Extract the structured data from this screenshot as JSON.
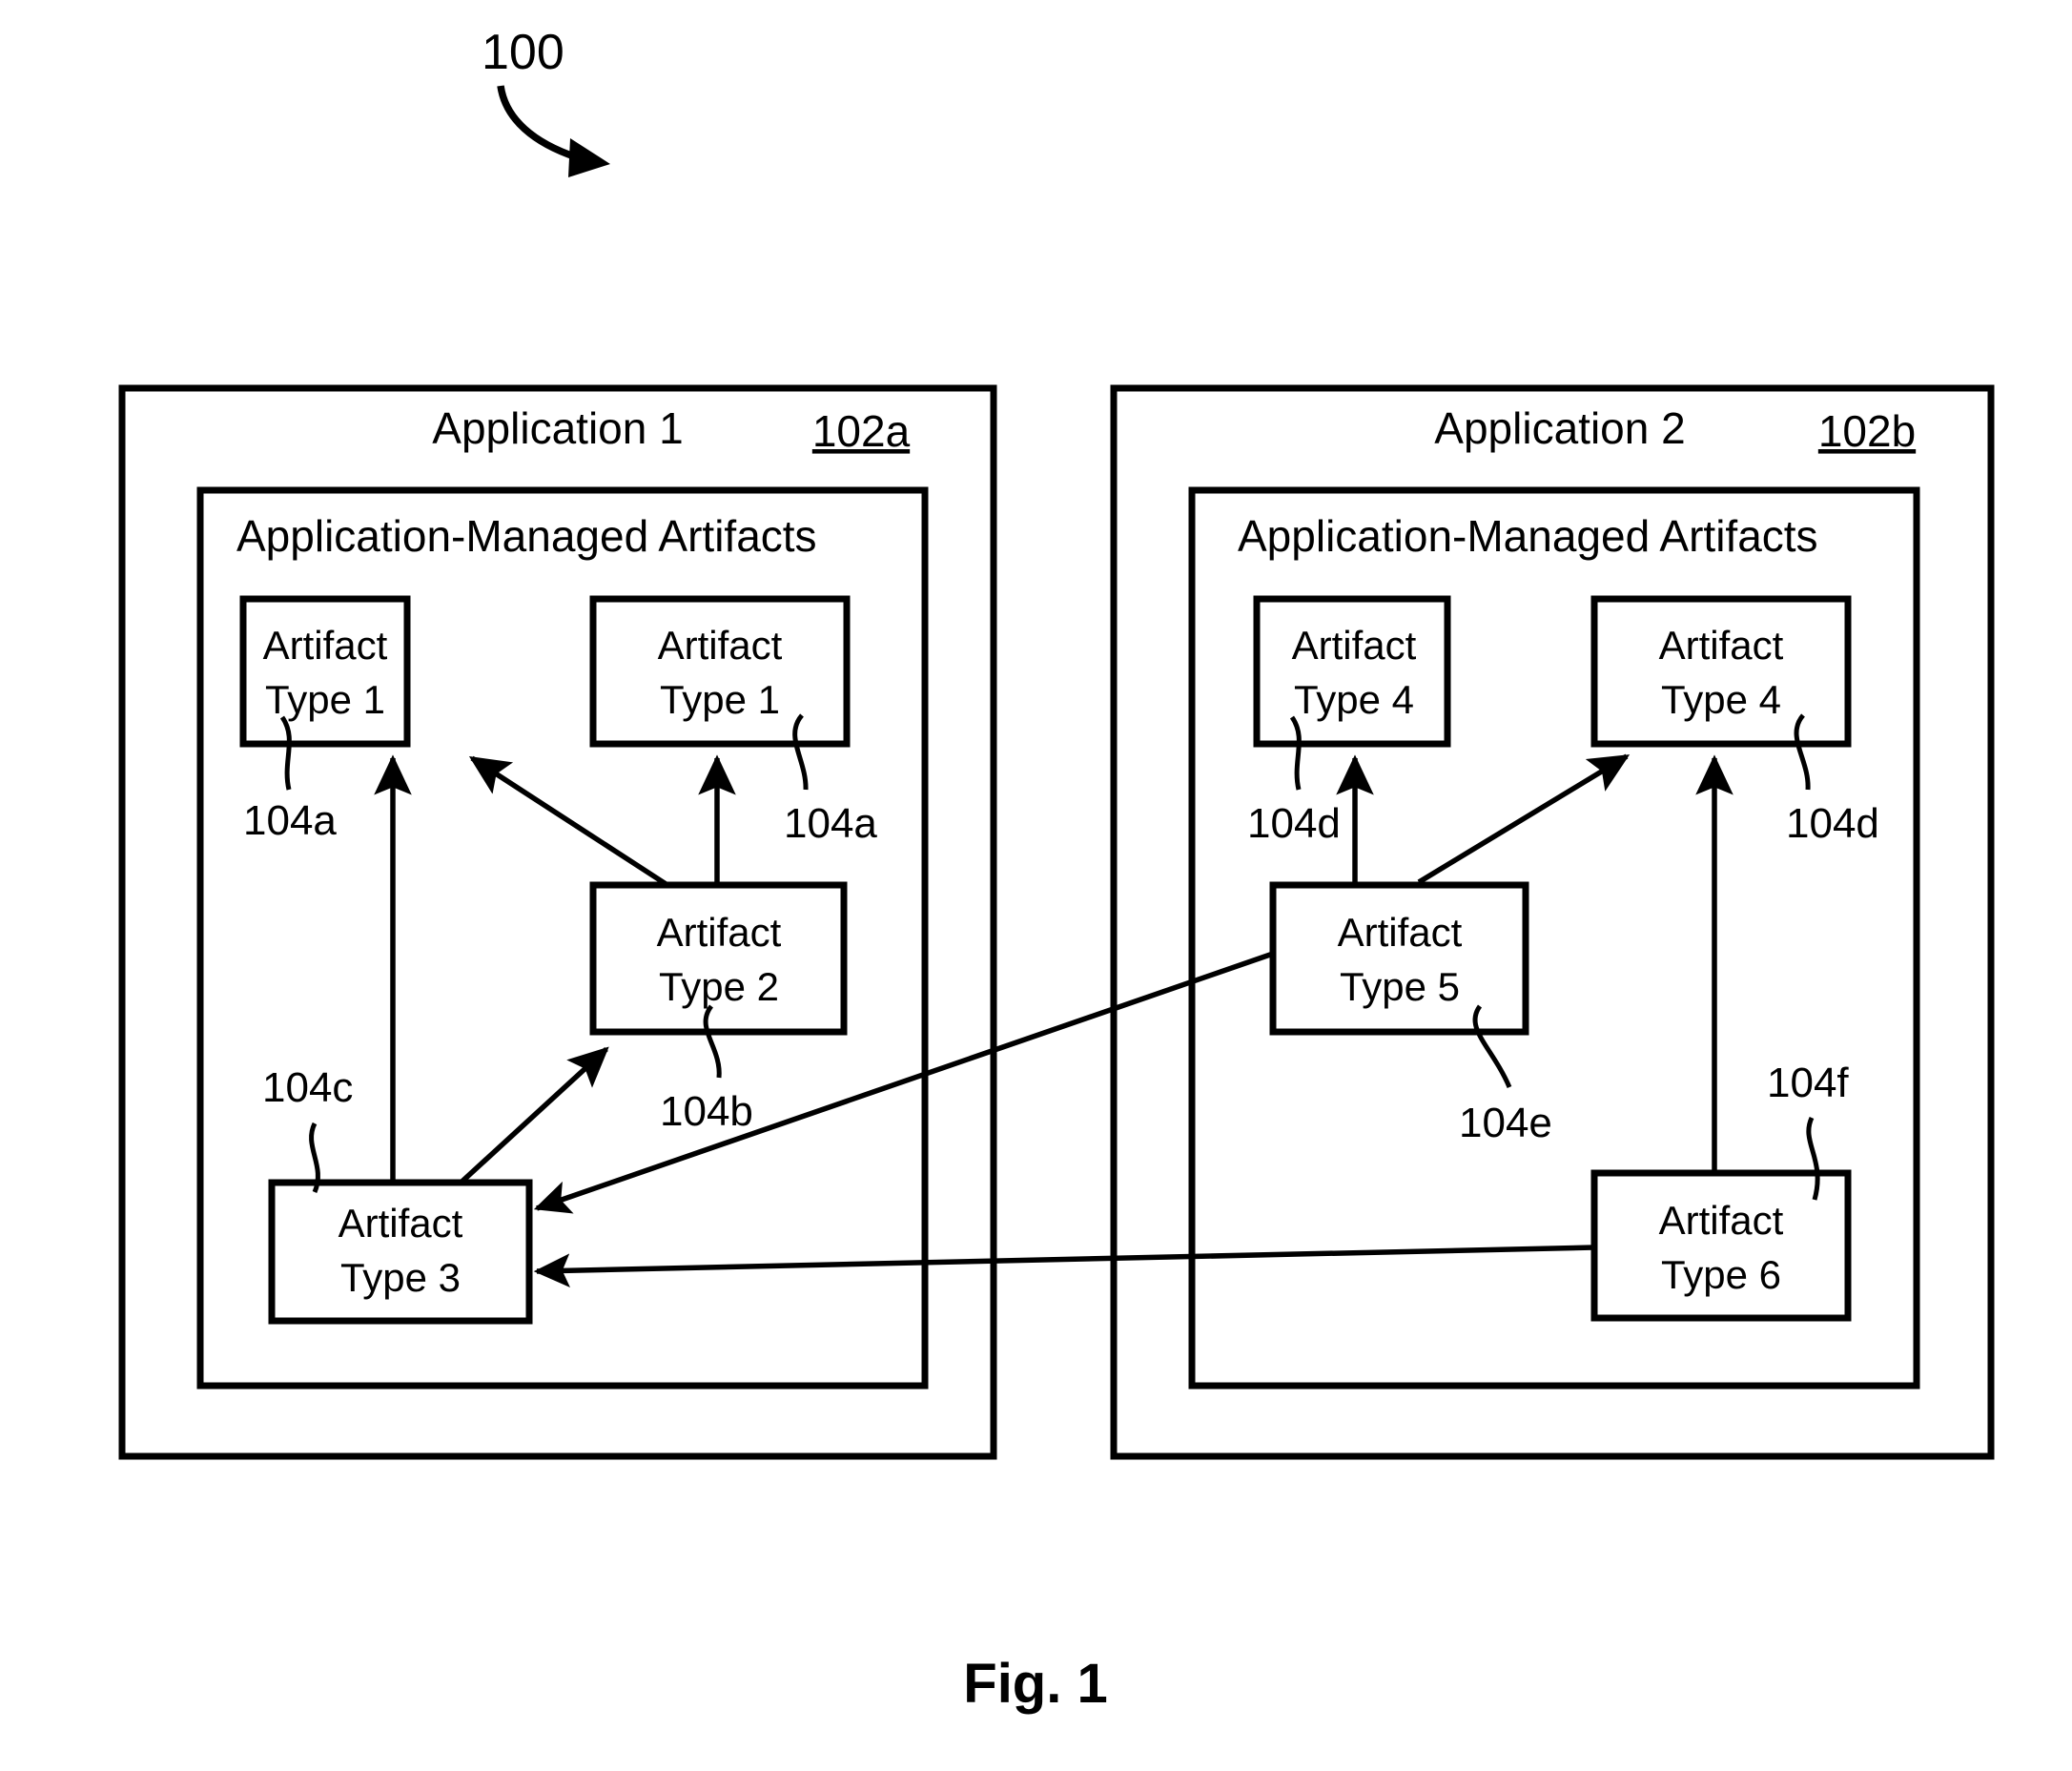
{
  "figure": {
    "callout_number": "100",
    "caption": "Fig. 1"
  },
  "applications": [
    {
      "id": "app1",
      "title": "Application 1",
      "ref": "102a",
      "section_title": "Application-Managed Artifacts",
      "artifacts": [
        {
          "id": "a1",
          "line1": "Artifact",
          "line2": "Type 1",
          "ref": "104a"
        },
        {
          "id": "a2",
          "line1": "Artifact",
          "line2": "Type 1",
          "ref": "104a"
        },
        {
          "id": "a3",
          "line1": "Artifact",
          "line2": "Type 2",
          "ref": "104b"
        },
        {
          "id": "a4",
          "line1": "Artifact",
          "line2": "Type 3",
          "ref": "104c"
        }
      ]
    },
    {
      "id": "app2",
      "title": "Application 2",
      "ref": "102b",
      "section_title": "Application-Managed Artifacts",
      "artifacts": [
        {
          "id": "b1",
          "line1": "Artifact",
          "line2": "Type 4",
          "ref": "104d"
        },
        {
          "id": "b2",
          "line1": "Artifact",
          "line2": "Type 4",
          "ref": "104d"
        },
        {
          "id": "b3",
          "line1": "Artifact",
          "line2": "Type 5",
          "ref": "104e"
        },
        {
          "id": "b4",
          "line1": "Artifact",
          "line2": "Type 6",
          "ref": "104f"
        }
      ]
    }
  ],
  "colors": {
    "stroke": "#000000",
    "background": "#ffffff"
  }
}
